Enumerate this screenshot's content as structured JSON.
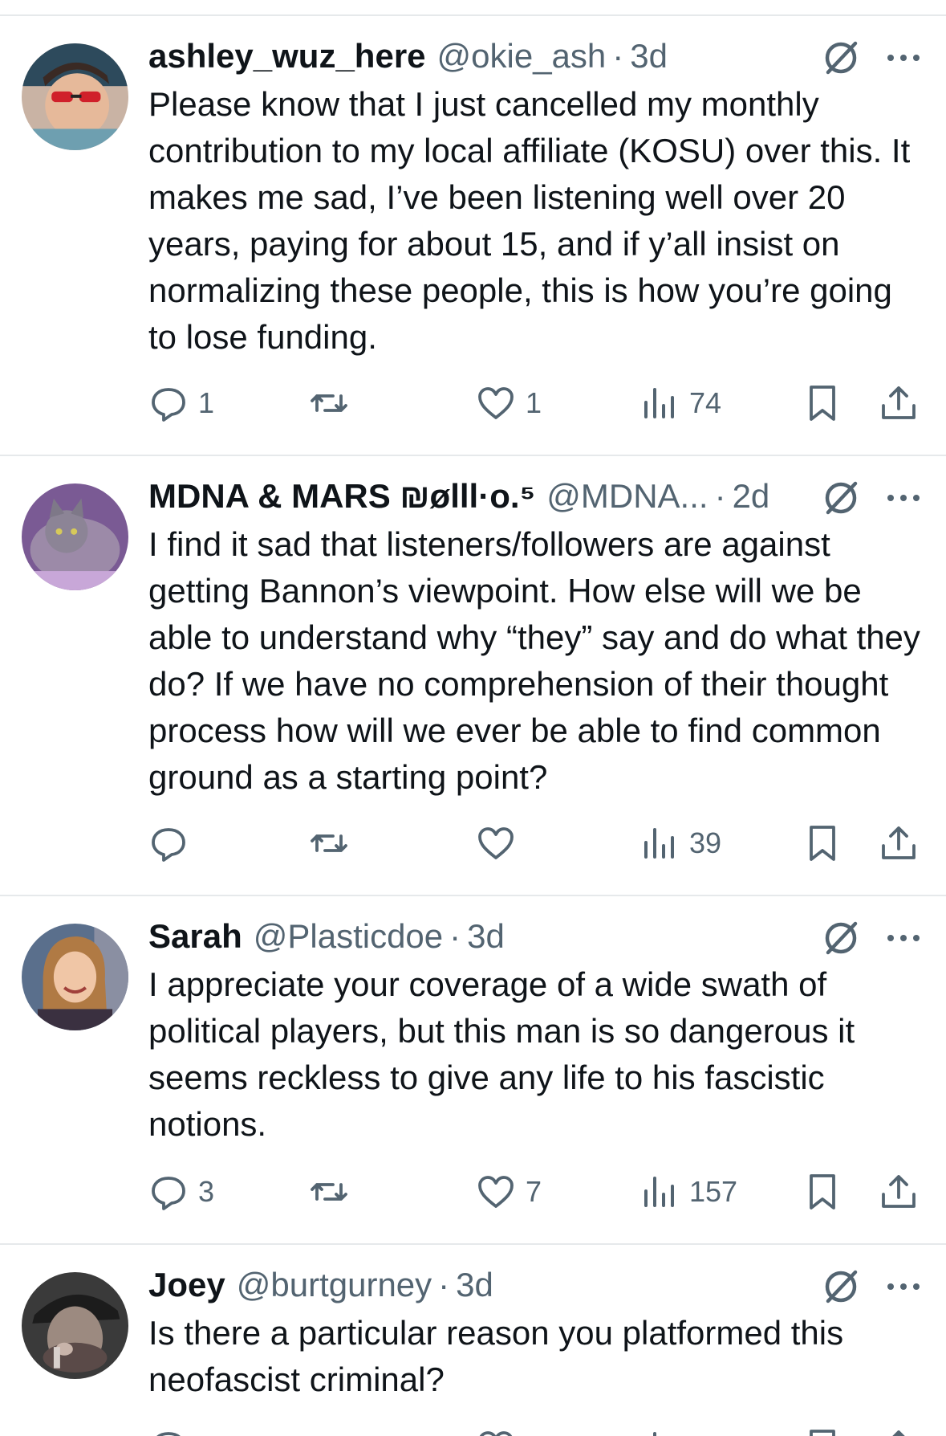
{
  "tweets": [
    {
      "name": "ashley_wuz_here",
      "handle": "@okie_ash",
      "dot": "·",
      "time": "3d",
      "text": "Please know that I just cancelled my monthly contribution to my local affiliate (KOSU) over this. It makes me sad, I’ve been listening well over 20 years, paying for about 15, and if y’all insist on normalizing these people, this is how you’re going to lose funding.",
      "replies": "1",
      "retweets": "",
      "likes": "1",
      "views": "74"
    },
    {
      "name": "MDNA & MARS ₪ølll·o.⁵",
      "handle": "@MDNA...",
      "dot": "·",
      "time": "2d",
      "text": "I find it sad that listeners/followers are against getting Bannon’s viewpoint. How else will we be able to understand why “they” say and do what they do? If we have no comprehension of their thought process how will we ever be able to find common ground as a starting point?",
      "replies": "",
      "retweets": "",
      "likes": "",
      "views": "39"
    },
    {
      "name": "Sarah",
      "handle": "@Plasticdoe",
      "dot": "·",
      "time": "3d",
      "text": "I appreciate your coverage of a wide swath of political players, but this man is so dangerous it seems reckless to give any life to his fascistic notions.",
      "replies": "3",
      "retweets": "",
      "likes": "7",
      "views": "157"
    },
    {
      "name": "Joey",
      "handle": "@burtgurney",
      "dot": "·",
      "time": "3d",
      "text": "Is there a particular reason you platformed this neofascist criminal?",
      "replies": "",
      "retweets": "",
      "likes": "",
      "views": ""
    }
  ],
  "icons": {
    "reply": "speech-bubble",
    "retweet": "retweet-arrows",
    "like": "heart",
    "views": "bar-chart",
    "bookmark": "bookmark",
    "share": "upload-arrow",
    "grok": "slashed-circle",
    "more": "horizontal-ellipsis"
  },
  "colors": {
    "text": "#0f1419",
    "secondary": "#536471",
    "divider": "#e6e9eb"
  }
}
